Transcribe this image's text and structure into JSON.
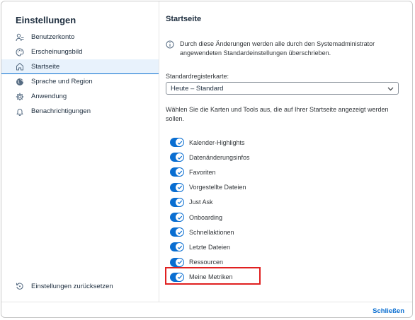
{
  "sidebar": {
    "title": "Einstellungen",
    "items": [
      {
        "label": "Benutzerkonto",
        "icon": "user-icon"
      },
      {
        "label": "Erscheinungsbild",
        "icon": "palette-icon"
      },
      {
        "label": "Startseite",
        "icon": "home-icon",
        "active": true
      },
      {
        "label": "Sprache und Region",
        "icon": "globe-icon"
      },
      {
        "label": "Anwendung",
        "icon": "gear-icon"
      },
      {
        "label": "Benachrichtigungen",
        "icon": "bell-icon"
      }
    ],
    "reset_label": "Einstellungen zurücksetzen"
  },
  "main": {
    "title": "Startseite",
    "info_text": "Durch diese Änderungen werden alle durch den Systemadministrator angewendeten Standardeinstellungen überschrieben.",
    "select_label": "Standardregisterkarte:",
    "select_value": "Heute – Standard",
    "description": "Wählen Sie die Karten und Tools aus, die auf Ihrer Startseite angezeigt werden sollen.",
    "toggles": [
      {
        "label": "Kalender-Highlights",
        "on": true
      },
      {
        "label": "Datenänderungsinfos",
        "on": true
      },
      {
        "label": "Favoriten",
        "on": true
      },
      {
        "label": "Vorgestellte Dateien",
        "on": true
      },
      {
        "label": "Just Ask",
        "on": true
      },
      {
        "label": "Onboarding",
        "on": true
      },
      {
        "label": "Schnellaktionen",
        "on": true
      },
      {
        "label": "Letzte Dateien",
        "on": true
      },
      {
        "label": "Ressourcen",
        "on": true
      },
      {
        "label": "Meine Metriken",
        "on": true
      }
    ]
  },
  "footer": {
    "close_label": "Schließen"
  },
  "colors": {
    "accent": "#0a6ed1",
    "highlight": "#e02020"
  }
}
